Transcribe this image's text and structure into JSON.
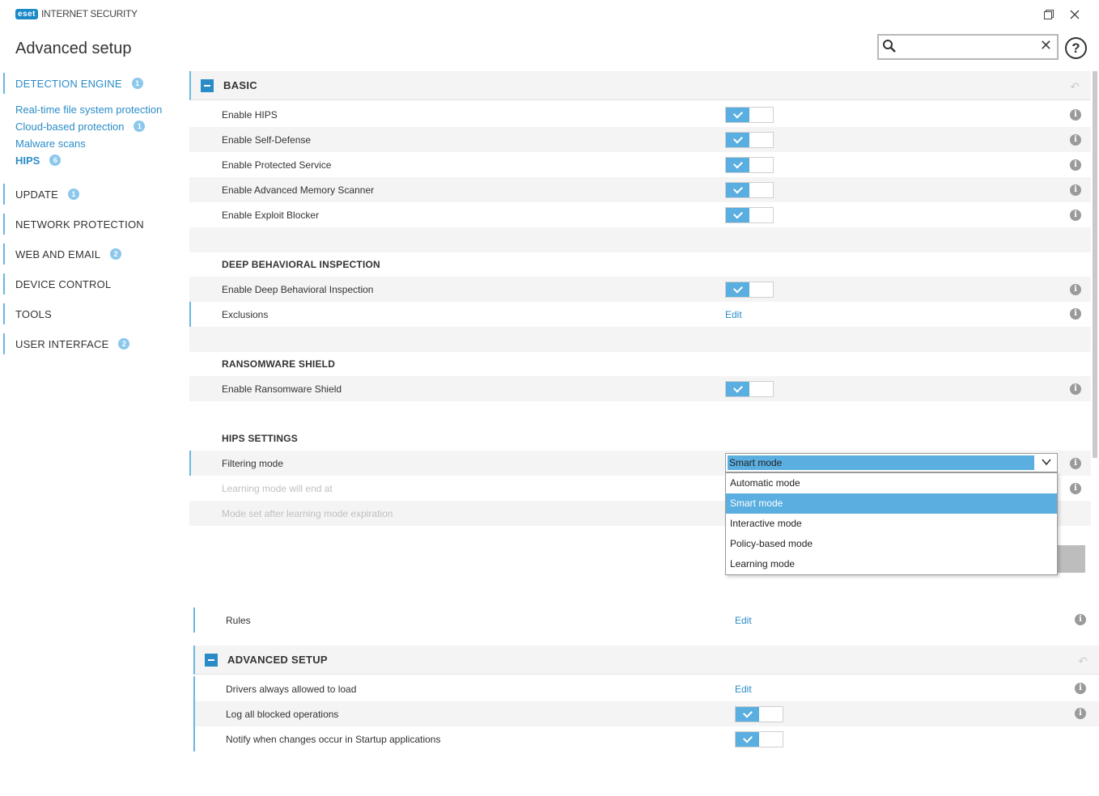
{
  "app": {
    "logo_badge": "eset",
    "logo_text": "INTERNET SECURITY",
    "title": "Advanced setup"
  },
  "window": {
    "restore_glyph": "❐",
    "close_glyph": "✕"
  },
  "search": {
    "placeholder": "",
    "value": "",
    "clear_glyph": "✕"
  },
  "help_glyph": "?",
  "sidebar": {
    "top": [
      {
        "label": "DETECTION ENGINE",
        "badge": "1"
      },
      {
        "label": "UPDATE",
        "badge": "1"
      },
      {
        "label": "NETWORK PROTECTION",
        "badge": ""
      },
      {
        "label": "WEB AND EMAIL",
        "badge": "2"
      },
      {
        "label": "DEVICE CONTROL",
        "badge": ""
      },
      {
        "label": "TOOLS",
        "badge": ""
      },
      {
        "label": "USER INTERFACE",
        "badge": "2"
      }
    ],
    "sub": [
      {
        "label": "Real-time file system protection",
        "badge": ""
      },
      {
        "label": "Cloud-based protection",
        "badge": "1"
      },
      {
        "label": "Malware scans",
        "badge": ""
      },
      {
        "label": "HIPS",
        "badge": "6"
      }
    ]
  },
  "basic": {
    "title": "BASIC",
    "rows": [
      {
        "label": "Enable HIPS",
        "enabled": true
      },
      {
        "label": "Enable Self-Defense",
        "enabled": true
      },
      {
        "label": "Enable Protected Service",
        "enabled": true
      },
      {
        "label": "Enable Advanced Memory Scanner",
        "enabled": true
      },
      {
        "label": "Enable Exploit Blocker",
        "enabled": true
      }
    ],
    "deep": {
      "title": "DEEP BEHAVIORAL INSPECTION",
      "enable_label": "Enable Deep Behavioral Inspection",
      "exclusions_label": "Exclusions",
      "exclusions_link": "Edit"
    },
    "ransomware": {
      "title": "RANSOMWARE SHIELD",
      "enable_label": "Enable Ransomware Shield"
    },
    "hips_settings": {
      "title": "HIPS SETTINGS",
      "filtering_label": "Filtering mode",
      "filtering_value": "Smart mode",
      "learning_end_label": "Learning mode will end at",
      "mode_after_label": "Mode set after learning mode expiration"
    }
  },
  "dropdown": {
    "options": [
      "Automatic mode",
      "Smart mode",
      "Interactive mode",
      "Policy-based mode",
      "Learning mode"
    ],
    "selected": "Smart mode"
  },
  "rules": {
    "label": "Rules",
    "link": "Edit"
  },
  "advanced_setup": {
    "title": "ADVANCED SETUP",
    "drivers_label": "Drivers always allowed to load",
    "drivers_link": "Edit",
    "log_label": "Log all blocked operations",
    "notify_label": "Notify when changes occur in Startup applications"
  },
  "info_glyph": "i",
  "colors": {
    "accent": "#2a8cc7",
    "toggle_on": "#5aaee0",
    "badge": "#8cc7ec"
  }
}
